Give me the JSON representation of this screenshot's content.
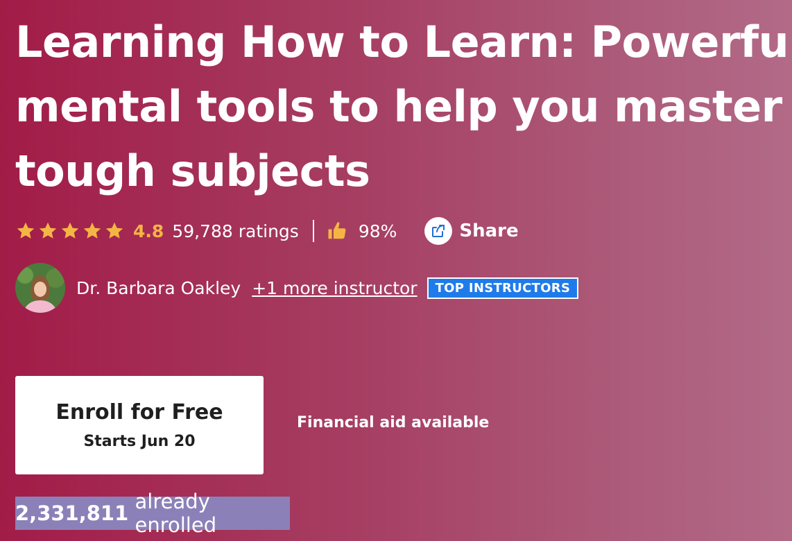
{
  "course": {
    "title_lines": [
      "Learning How to Learn: Powerful",
      "mental tools to help you master",
      "tough subjects"
    ]
  },
  "rating": {
    "stars": 5,
    "value": "4.8",
    "count_text": "59,788 ratings",
    "thumbs_percent": "98%",
    "icons": [
      "star-icon",
      "thumbs-up-icon"
    ],
    "star_color": "#f5b544"
  },
  "share": {
    "label": "Share",
    "icon": "share-icon"
  },
  "instructor": {
    "name": "Dr. Barbara Oakley",
    "more_link": "+1 more instructor",
    "badge": "TOP INSTRUCTORS",
    "badge_color": "#1f7bea"
  },
  "enroll": {
    "label": "Enroll for Free",
    "starts": "Starts Jun 20"
  },
  "financial_aid": "Financial aid available",
  "enrolled": {
    "count": "2,331,811",
    "suffix": "already enrolled"
  },
  "colors": {
    "background_start": "#a21c48",
    "background_end": "#b26a87",
    "selection_highlight": "#8b81b8"
  }
}
